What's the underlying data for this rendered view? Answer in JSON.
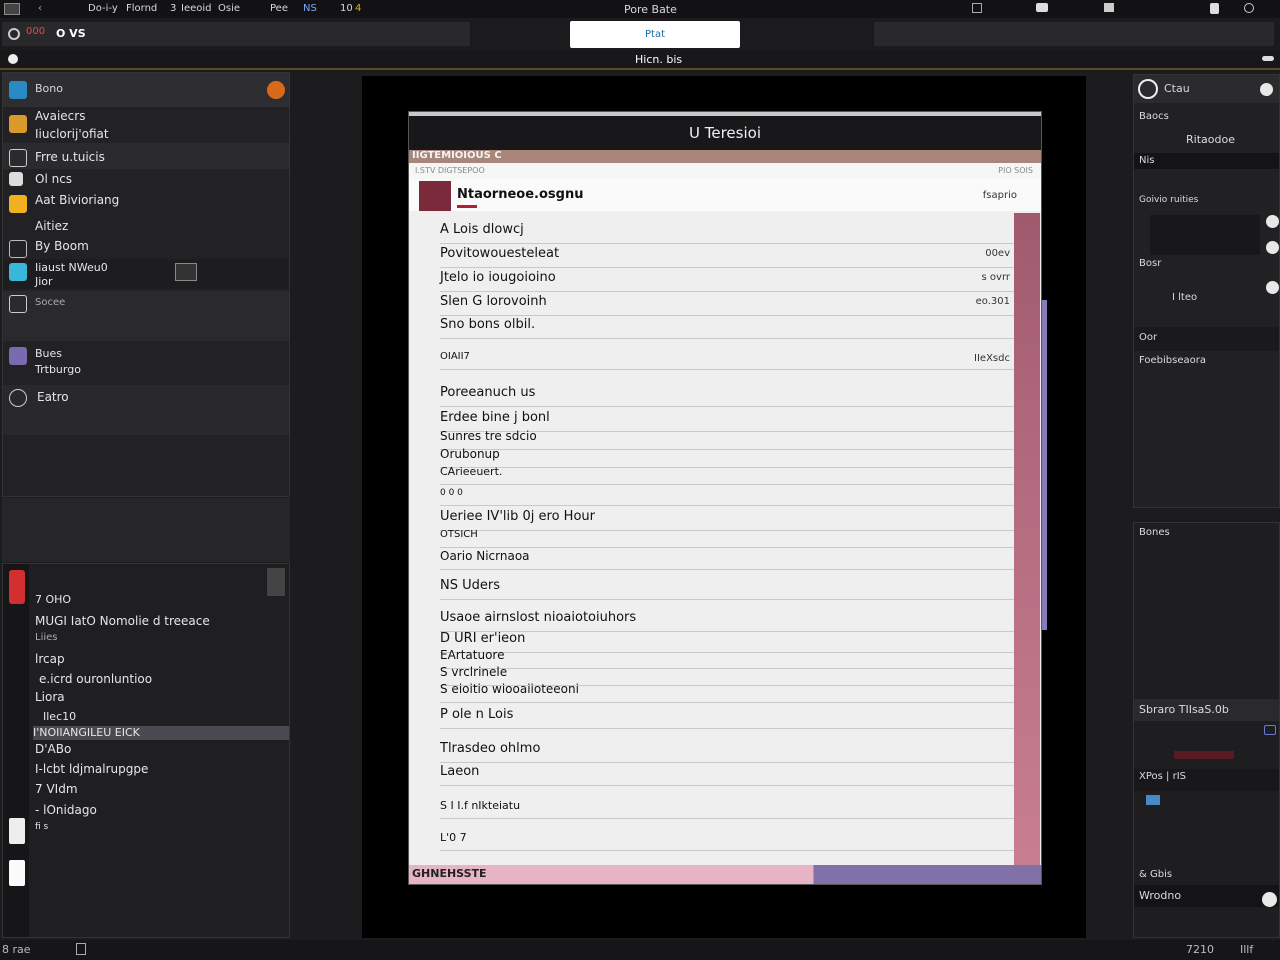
{
  "topbar": {
    "items": [
      "Do-i-y",
      "Flornd",
      "3",
      "Ieeoid",
      "Osie",
      "Pee",
      "NS",
      "10",
      "4",
      "",
      ""
    ],
    "title": "Pore Bate"
  },
  "toolbar": {
    "field_value": "O VS",
    "center_button": "Ptat",
    "badge": "000"
  },
  "tabbar": {
    "label": "Hicn. bis"
  },
  "left_panel": {
    "header": "Bono",
    "items": [
      {
        "label": "Avaiecrs"
      },
      {
        "label": "Iiuclorij'ofiat"
      },
      {
        "label": "Frre u.tuicis"
      },
      {
        "label": "Ol ncs"
      },
      {
        "label": "Aat Bivioriang"
      },
      {
        "label": "Aitiez"
      },
      {
        "label": "By Boom"
      },
      {
        "label": "Iiaust NWeu0"
      },
      {
        "label": "Jior"
      },
      {
        "label": "Socee"
      },
      {
        "label": "Bues"
      },
      {
        "label": "Trtburgo"
      },
      {
        "label": "Eatro"
      }
    ]
  },
  "left_panel2": {
    "items": [
      {
        "label": "7 OHO"
      },
      {
        "label": "MUGI IatO Nomolie d treeace"
      },
      {
        "label": "Liies"
      },
      {
        "label": "lrcap"
      },
      {
        "label": "e.icrd ouronluntioo"
      },
      {
        "label": "Liora"
      },
      {
        "label": "Ilec10"
      },
      {
        "label": "I'NOIIANGILEU EICK"
      },
      {
        "label": "D'ABo"
      },
      {
        "label": "I-lcbt ldjmalrupgpe"
      },
      {
        "label": "7 VIdm"
      },
      {
        "label": "- lOnidago"
      },
      {
        "label": "fi s"
      }
    ]
  },
  "document": {
    "title": "U Teresioi",
    "band": "IIGTEMIOIOUS C",
    "sub_left": "I.STV DIGTSEPOO",
    "sub_right": "PIO SOIS",
    "header_name": "Ntaorneoe.osgnu",
    "header_right": "fsaprio",
    "rows": [
      {
        "label": "A Lois dlowcj",
        "value": ""
      },
      {
        "label": "Povitowouesteleat",
        "value": "00ev"
      },
      {
        "label": "Jtelo io iougoioino",
        "value": "s ovrr"
      },
      {
        "label": "Slen G lorovoinh",
        "value": "eo.301"
      },
      {
        "label": "Sno bons olbil.",
        "value": ""
      },
      {
        "label": "OIAII7",
        "value": "IIeXsdc"
      },
      {
        "label": "Poreeanuch us",
        "value": ""
      },
      {
        "label": "Erdee bine j bonl",
        "value": ""
      },
      {
        "label": "Sunres tre sdcio",
        "value": ""
      },
      {
        "label": "Orubonup",
        "value": ""
      },
      {
        "label": "CArieeuert.",
        "value": ""
      },
      {
        "label": "0 0 0",
        "value": ""
      },
      {
        "label": "Ueriee IV'lib 0j ero Hour",
        "value": ""
      },
      {
        "label": "OTSICH",
        "value": ""
      },
      {
        "label": "Oario Nicrnaoa",
        "value": ""
      },
      {
        "label": "NS Uders",
        "value": ""
      },
      {
        "label": "Usaoe airnslost nioaiotoiuhors",
        "value": ""
      },
      {
        "label": "D URI er'ieon",
        "value": ""
      },
      {
        "label": "EArtatuore",
        "value": ""
      },
      {
        "label": "S vrclrinele",
        "value": ""
      },
      {
        "label": "S eioitio wiooaiioteeoni",
        "value": ""
      },
      {
        "label": "P ole n Lois",
        "value": ""
      },
      {
        "label": "Tlrasdeo ohlmo",
        "value": ""
      },
      {
        "label": "Laeon",
        "value": ""
      },
      {
        "label": "S I I.f nIkteiatu",
        "value": ""
      },
      {
        "label": "L'0 7",
        "value": ""
      }
    ],
    "footer": "GHNEHSSTE"
  },
  "right_panel": {
    "header": "Ctau",
    "items": [
      "Baocs",
      "Ritaodoe",
      "Nis",
      "Goivio ruities",
      "Bosr",
      "I lteo",
      "Oor",
      "Foebibseaora"
    ]
  },
  "right_panel2": {
    "items": [
      "Bones",
      "Sbraro  TIIsaS.0b",
      "XPos | rIS",
      "& Gbis",
      "Wrodno"
    ]
  },
  "statusbar": {
    "left": "8 rae",
    "right_a": "7210",
    "right_b": "Illf"
  }
}
